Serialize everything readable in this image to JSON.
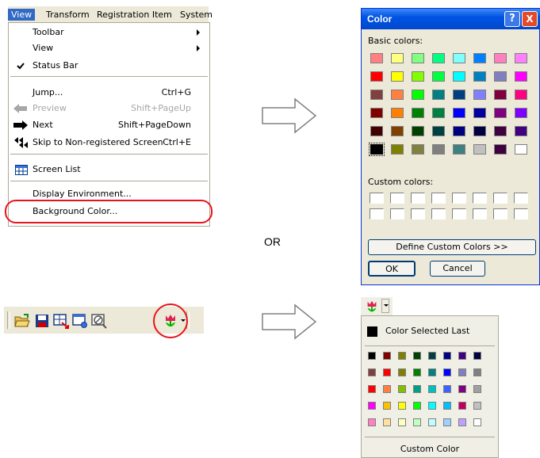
{
  "menubar": {
    "items": [
      "View",
      "Transform",
      "Registration Item",
      "System"
    ]
  },
  "menu": {
    "toolbar": "Toolbar",
    "view": "View",
    "status_bar": "Status Bar",
    "jump": "Jump...",
    "jump_shortcut": "Ctrl+G",
    "preview": "Preview",
    "preview_shortcut": "Shift+PageUp",
    "next": "Next",
    "next_shortcut": "Shift+PageDown",
    "skip": "Skip to Non-registered Screen",
    "skip_shortcut": "Ctrl+E",
    "screen_list": "Screen List",
    "display_env": "Display Environment...",
    "background_color": "Background Color..."
  },
  "or_label": "OR",
  "color_dialog": {
    "title": "Color",
    "help_btn": "?",
    "close_btn": "X",
    "basic_colors_label": "Basic colors:",
    "custom_colors_label": "Custom colors:",
    "define_custom": "Define Custom Colors >>",
    "ok": "OK",
    "cancel": "Cancel",
    "basic_colors": [
      "#ff8080",
      "#ffff80",
      "#80ff80",
      "#00ff80",
      "#80ffff",
      "#0080ff",
      "#ff80c0",
      "#ff80ff",
      "#ff0000",
      "#ffff00",
      "#80ff00",
      "#00ff40",
      "#00ffff",
      "#0080c0",
      "#8080c0",
      "#ff00ff",
      "#804040",
      "#ff8040",
      "#00ff00",
      "#008080",
      "#004080",
      "#8080ff",
      "#800040",
      "#ff0080",
      "#800000",
      "#ff8000",
      "#008000",
      "#008040",
      "#0000ff",
      "#0000a0",
      "#800080",
      "#8000ff",
      "#400000",
      "#804000",
      "#004000",
      "#004040",
      "#000080",
      "#000040",
      "#400040",
      "#400080",
      "#000000",
      "#808000",
      "#808040",
      "#808080",
      "#408080",
      "#c0c0c0",
      "#400040",
      "#ffffff"
    ]
  },
  "palette": {
    "color_selected_last": "Color Selected Last",
    "custom_color": "Custom Color",
    "colors": [
      "#000000",
      "#800000",
      "#808000",
      "#004000",
      "#004040",
      "#000080",
      "#400080",
      "#000040",
      "#804040",
      "#ff0000",
      "#808000",
      "#008000",
      "#008080",
      "#0000ff",
      "#8080c0",
      "#808080",
      "#ff0000",
      "#ff8040",
      "#80c000",
      "#00a080",
      "#00c0c0",
      "#4060ff",
      "#800080",
      "#a0a0a0",
      "#ff00ff",
      "#ffc000",
      "#ffff00",
      "#00ff00",
      "#00ffff",
      "#00c0ff",
      "#c00060",
      "#c0c0c0",
      "#ff80c0",
      "#ffe0a0",
      "#ffffc0",
      "#c0ffc0",
      "#c0ffff",
      "#a0d0ff",
      "#c0a0ff",
      "#ffffff"
    ]
  }
}
